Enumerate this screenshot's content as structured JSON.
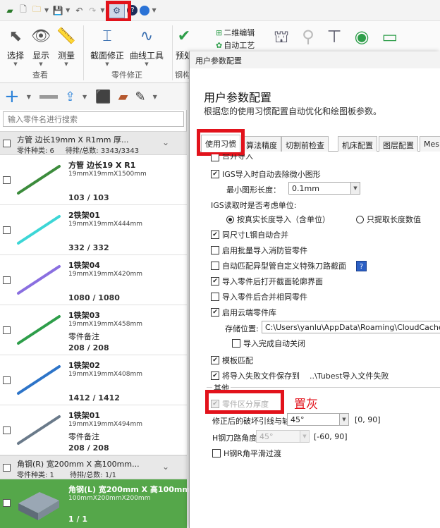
{
  "ribbon": {
    "buttons": [
      {
        "label": "选择",
        "icon": "cursor-icon",
        "glyph": "⬉"
      },
      {
        "label": "显示",
        "icon": "eye-icon",
        "glyph": "👁"
      },
      {
        "label": "测量",
        "icon": "ruler-icon",
        "glyph": "📏"
      },
      {
        "label": "截面修正",
        "icon": "i-beam-icon",
        "glyph": "⌶"
      },
      {
        "label": "曲线工具",
        "icon": "curve-icon",
        "glyph": "∿"
      },
      {
        "label": "预处",
        "icon": "check-icon",
        "glyph": "✔"
      }
    ],
    "groups": [
      "查看",
      "零件修正",
      "钢构"
    ],
    "small": [
      "二维编辑",
      "自动工艺"
    ]
  },
  "left": {
    "search_placeholder": "输入零件名进行搜索",
    "group1": {
      "title": "方管 边长19mm X R1mm 厚...",
      "kinds": "零件种类: 6",
      "progress": "待排/总数: 3343/3343"
    },
    "parts": [
      {
        "name": "方管 边长19 X R1",
        "dim": "19mmX19mmX1500mm",
        "note": "",
        "count": "103 / 103",
        "color": "#3c8c3c"
      },
      {
        "name": "2铁架01",
        "dim": "19mmX19mmX444mm",
        "note": "",
        "count": "332 / 332",
        "color": "#3dd6d6"
      },
      {
        "name": "1铁架04",
        "dim": "19mmX19mmX420mm",
        "note": "",
        "count": "1080 / 1080",
        "color": "#8a6fe0"
      },
      {
        "name": "1铁架03",
        "dim": "19mmX19mmX458mm",
        "note": "零件备注",
        "count": "208 / 208",
        "color": "#2e9e4a"
      },
      {
        "name": "1铁架02",
        "dim": "19mmX19mmX408mm",
        "note": "",
        "count": "1412 / 1412",
        "color": "#2d74c8"
      },
      {
        "name": "1铁架01",
        "dim": "19mmX19mmX494mm",
        "note": "零件备注",
        "count": "208 / 208",
        "color": "#6a7a8a"
      }
    ],
    "group2": {
      "title": "角钢(R) 宽200mm X 高100mm...",
      "kinds": "零件种类: 1",
      "progress": "待排/总数: 1/1"
    },
    "angle_part": {
      "name": "角钢(L) 宽200mm X 高100mm",
      "dim": "100mmX200mmX200mm",
      "count": "1 / 1"
    }
  },
  "dialog": {
    "window_title": "用户参数配置",
    "heading": "用户参数配置",
    "subtitle": "根据您的使用习惯配置自动优化和绘图板参数。",
    "tabs": [
      "使用习惯",
      "算法精度",
      "切割前检查",
      "机床配置",
      "图层配置",
      "Mes"
    ],
    "first_row_partial": "合并导入",
    "igs_remove_small": "IGS导入时自动去除微小图形",
    "min_len_label": "最小图形长度：",
    "min_len_value": "0.1mm",
    "igs_unit_label": "IGS读取时是否考虑单位:",
    "radio_real": "按真实长度导入（含单位）",
    "radio_value": "只提取长度数值",
    "merge_l_steel": "同尺寸L钢自动合并",
    "batch_fire_pipe": "启用批量导入消防管零件",
    "auto_match_section": "自动匹配异型管自定义特殊刀路截面",
    "open_section_page": "导入零件后打开截面轮廓界面",
    "merge_same_parts": "导入零件后合并相同零件",
    "cloud_lib": "启用云端零件库",
    "storage_label": "存储位置:",
    "storage_path": "C:\\Users\\yanlu\\AppData\\Roaming\\CloudCache",
    "auto_close": "导入完成自动关闭",
    "template_match": "模板匹配",
    "save_fail_file": "将导入失败文件保存到",
    "fail_path": "..\\Tubest导入文件失败",
    "other_section": "其他",
    "thickness_diff": "零件区分厚度",
    "grey_note": "置灰",
    "angle_label": "修正后的破坏引线与轴夹角：",
    "angle_value": "45°",
    "angle_range": "[0, 90]",
    "h_steel_label": "H钢刀路角度",
    "h_steel_value": "45°",
    "h_steel_range": "[-60, 90]",
    "h_r_smooth": "H钢R角平滑过渡"
  }
}
